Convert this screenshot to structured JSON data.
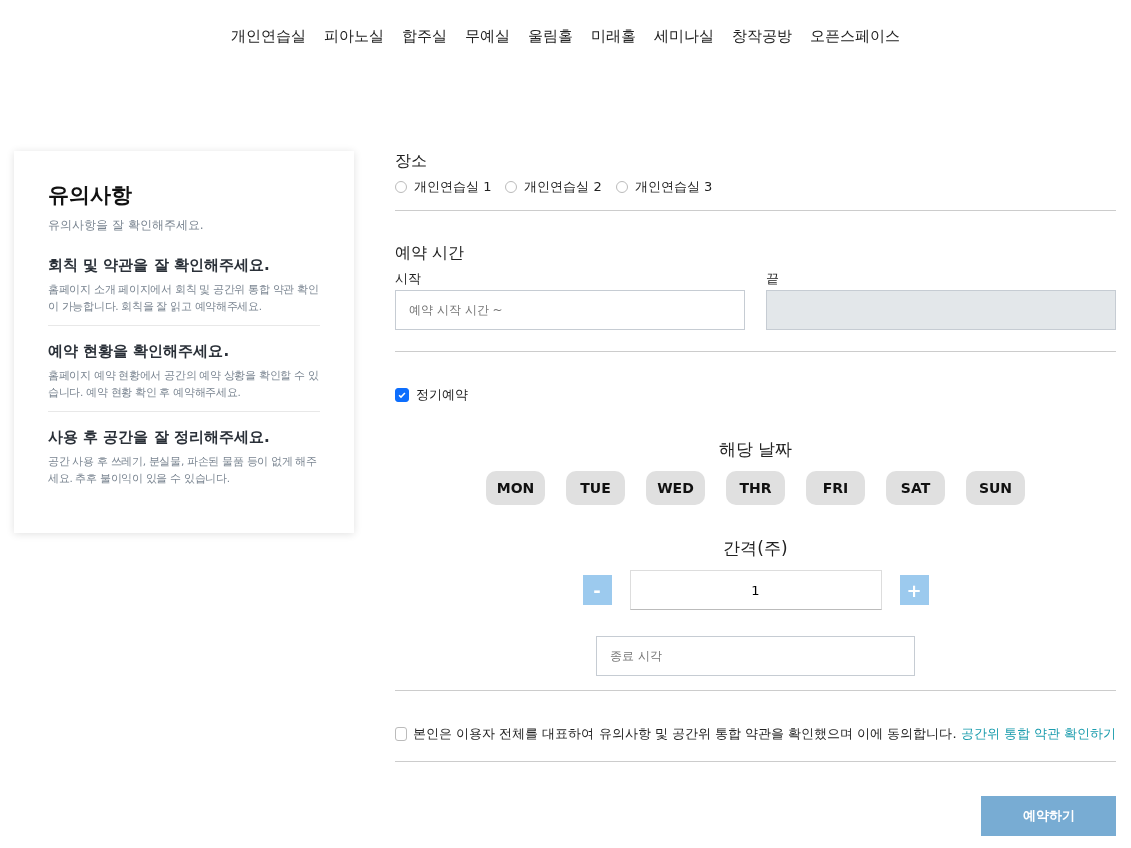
{
  "nav": {
    "items": [
      "개인연습실",
      "피아노실",
      "합주실",
      "무예실",
      "울림홀",
      "미래홀",
      "세미나실",
      "창작공방",
      "오픈스페이스"
    ]
  },
  "notice": {
    "title": "유의사항",
    "subtitle": "유의사항을 잘 확인해주세요.",
    "sections": [
      {
        "heading": "회칙 및 약관을 잘 확인해주세요.",
        "body": "홈페이지 소개 페이지에서 회칙 및 공간위 통합 약관 확인이 가능합니다. 회칙을 잘 읽고 예약해주세요."
      },
      {
        "heading": "예약 현황을 확인해주세요.",
        "body": "홈페이지 예약 현황에서 공간의 예약 상황을 확인할 수 있습니다. 예약 현황 확인 후 예약해주세요."
      },
      {
        "heading": "사용 후 공간을 잘 정리해주세요.",
        "body": "공간 사용 후 쓰레기, 분실물, 파손된 물품 등이 없게 해주세요. 추후 불이익이 있을 수 있습니다."
      }
    ]
  },
  "place": {
    "label": "장소",
    "options": [
      {
        "label": "개인연습실 1",
        "selected": false
      },
      {
        "label": "개인연습실 2",
        "selected": false
      },
      {
        "label": "개인연습실 3",
        "selected": false
      }
    ]
  },
  "time": {
    "label": "예약 시간",
    "start_label": "시작",
    "start_placeholder": "예약 시작 시간 ~",
    "end_label": "끝",
    "end_disabled": true
  },
  "recurring": {
    "label": "정기예약",
    "checked": true
  },
  "days": {
    "label": "해당 날짜",
    "items": [
      {
        "label": "MON",
        "selected": false
      },
      {
        "label": "TUE",
        "selected": false
      },
      {
        "label": "WED",
        "selected": false
      },
      {
        "label": "THR",
        "selected": false
      },
      {
        "label": "FRI",
        "selected": false
      },
      {
        "label": "SAT",
        "selected": false
      },
      {
        "label": "SUN",
        "selected": false
      }
    ]
  },
  "interval": {
    "label": "간격(주)",
    "minus": "-",
    "value": "1",
    "plus": "+"
  },
  "end_time": {
    "placeholder": "종료 시각"
  },
  "agreement": {
    "checked": false,
    "text": "본인은 이용자 전체를 대표하여 유의사항 및 공간위 통합 약관을 확인했으며 이에 동의합니다.",
    "link": "공간위 통합 약관 확인하기"
  },
  "submit": "예약하기"
}
